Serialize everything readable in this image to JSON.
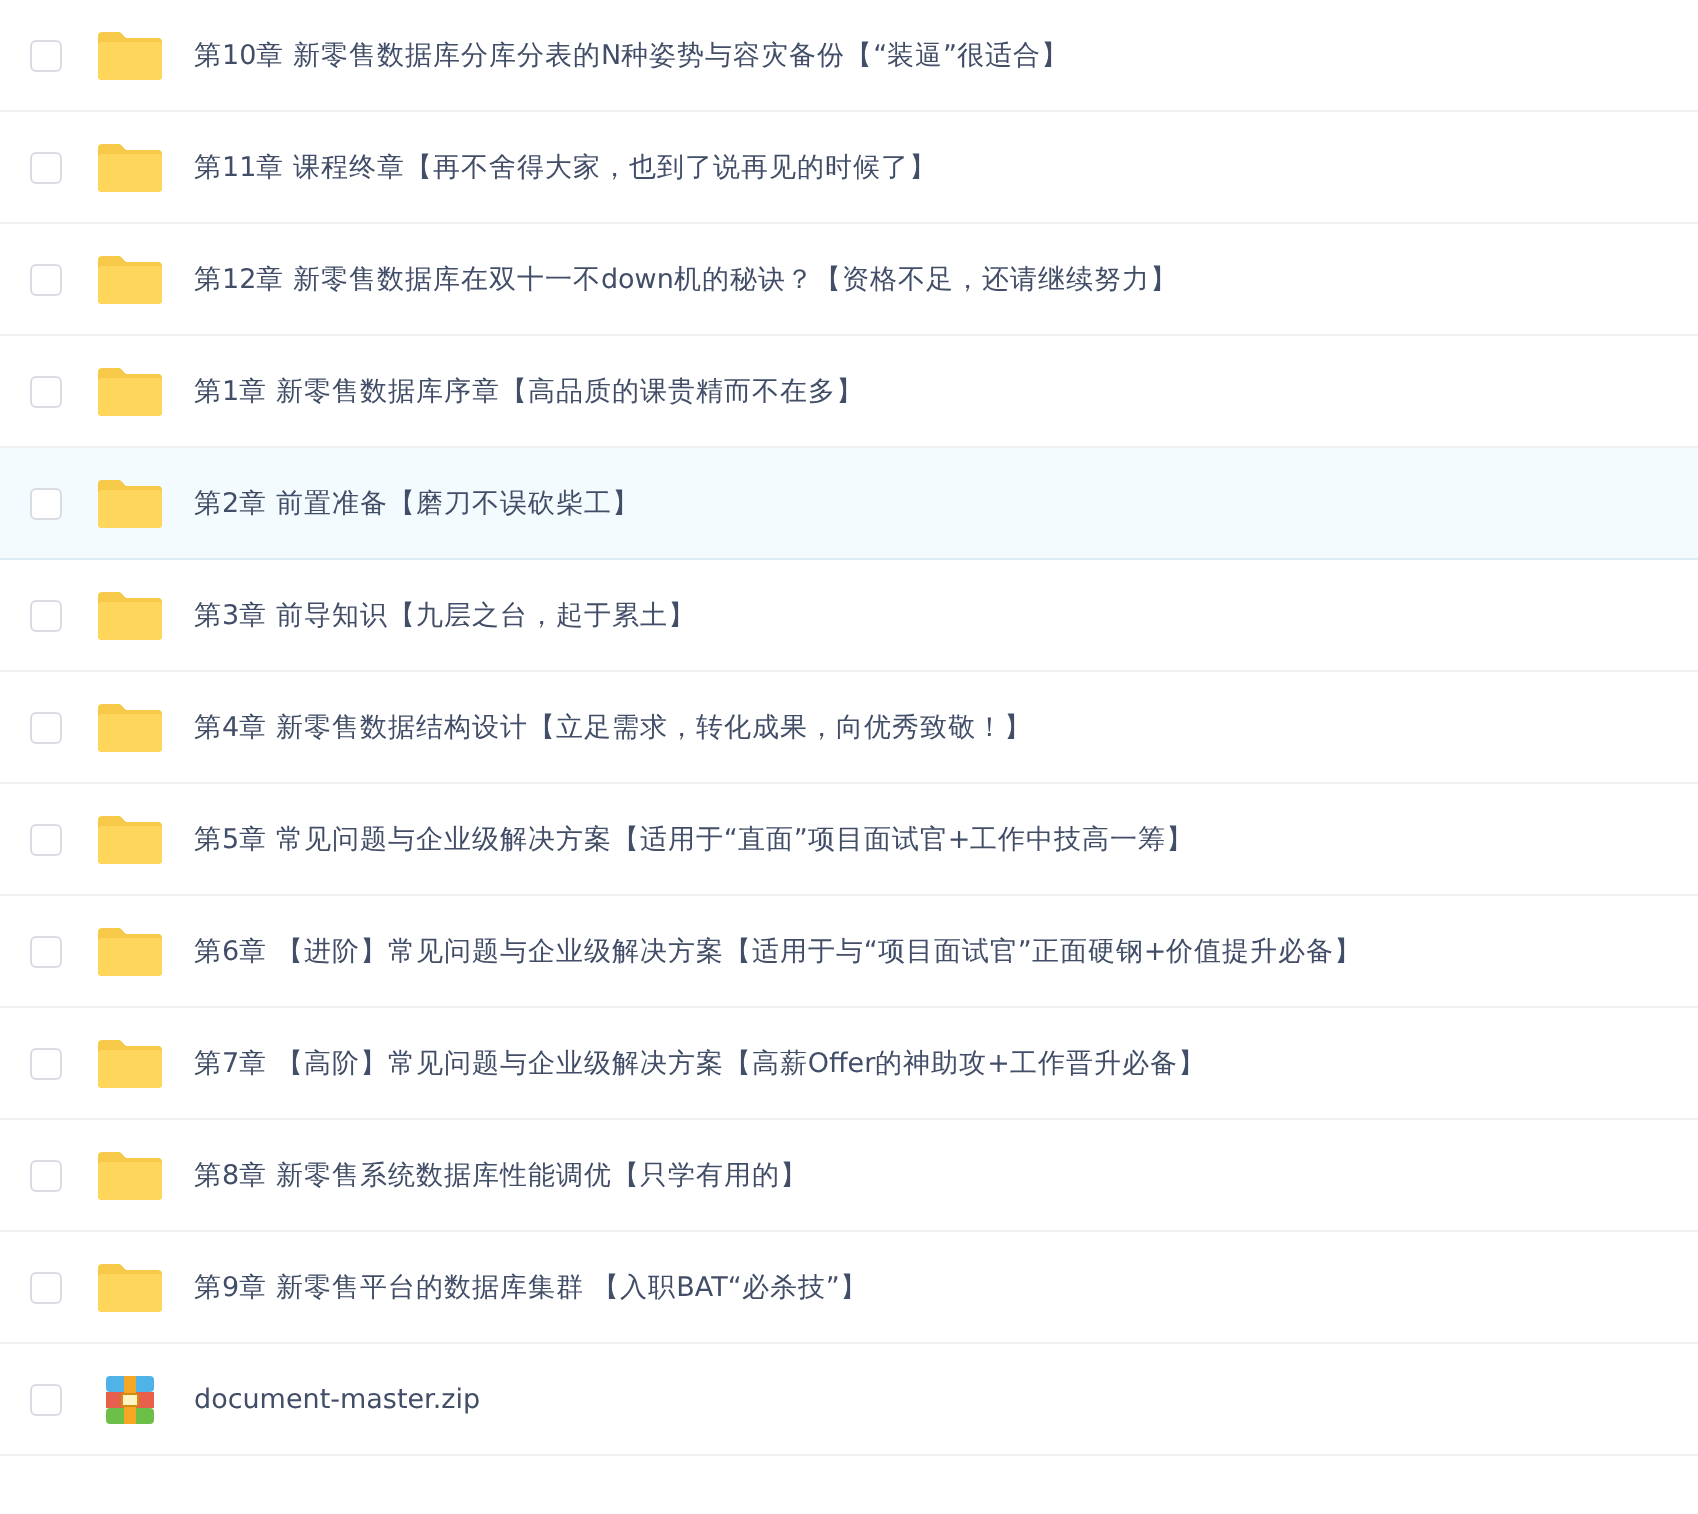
{
  "files": [
    {
      "kind": "folder",
      "name": "第10章 新零售数据库分库分表的N种姿势与容灾备份【“装逼”很适合】",
      "checked": false,
      "highlighted": false
    },
    {
      "kind": "folder",
      "name": "第11章 课程终章【再不舍得大家，也到了说再见的时候了】",
      "checked": false,
      "highlighted": false
    },
    {
      "kind": "folder",
      "name": "第12章 新零售数据库在双十一不down机的秘诀？【资格不足，还请继续努力】",
      "checked": false,
      "highlighted": false
    },
    {
      "kind": "folder",
      "name": "第1章 新零售数据库序章【高品质的课贵精而不在多】",
      "checked": false,
      "highlighted": false
    },
    {
      "kind": "folder",
      "name": "第2章 前置准备【磨刀不误砍柴工】",
      "checked": false,
      "highlighted": true
    },
    {
      "kind": "folder",
      "name": "第3章 前导知识【九层之台，起于累土】",
      "checked": false,
      "highlighted": false
    },
    {
      "kind": "folder",
      "name": "第4章 新零售数据结构设计【立足需求，转化成果，向优秀致敬！】",
      "checked": false,
      "highlighted": false
    },
    {
      "kind": "folder",
      "name": "第5章 常见问题与企业级解决方案【适用于“直面”项目面试官+工作中技高一筹】",
      "checked": false,
      "highlighted": false
    },
    {
      "kind": "folder",
      "name": "第6章 【进阶】常见问题与企业级解决方案【适用于与“项目面试官”正面硬钢+价值提升必备】",
      "checked": false,
      "highlighted": false
    },
    {
      "kind": "folder",
      "name": "第7章 【高阶】常见问题与企业级解决方案【高薪Offer的神助攻+工作晋升必备】",
      "checked": false,
      "highlighted": false
    },
    {
      "kind": "folder",
      "name": "第8章 新零售系统数据库性能调优【只学有用的】",
      "checked": false,
      "highlighted": false
    },
    {
      "kind": "folder",
      "name": "第9章 新零售平台的数据库集群 【入职BAT“必杀技”】",
      "checked": false,
      "highlighted": false
    },
    {
      "kind": "zip",
      "name": "document-master.zip",
      "checked": false,
      "highlighted": false
    }
  ]
}
